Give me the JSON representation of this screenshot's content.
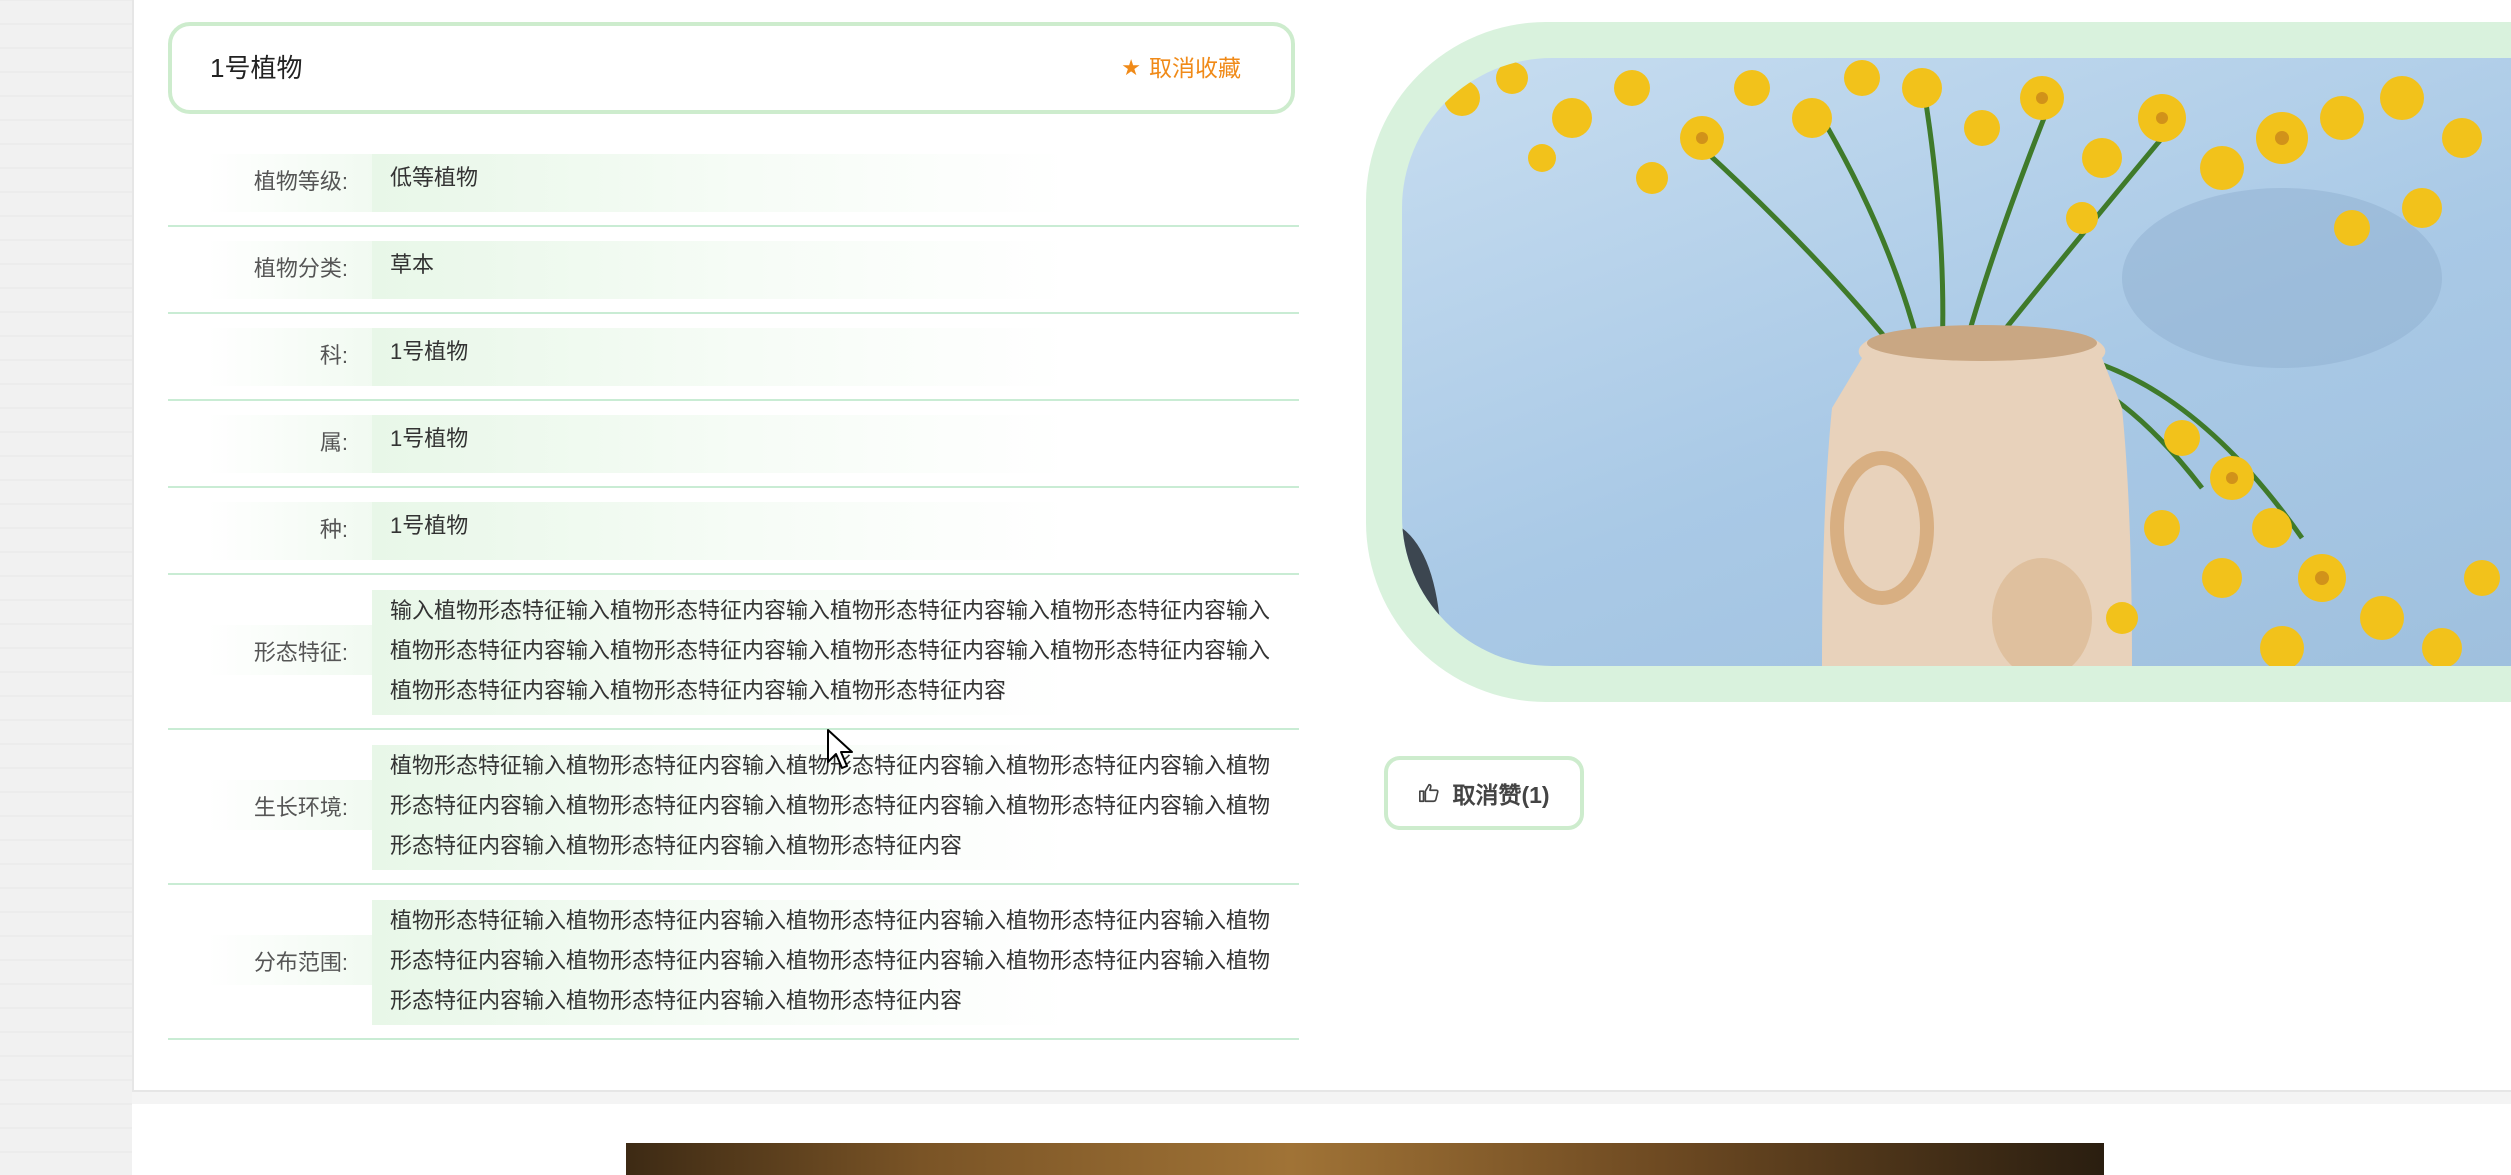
{
  "plant": {
    "title": "1号植物",
    "favorite_label": "取消收藏",
    "favorite_icon": "star-icon",
    "accent_color": "#f08a18"
  },
  "details": [
    {
      "label": "植物等级:",
      "value": "低等植物"
    },
    {
      "label": "植物分类:",
      "value": "草本"
    },
    {
      "label": "科:",
      "value": "1号植物"
    },
    {
      "label": "属:",
      "value": "1号植物"
    },
    {
      "label": "种:",
      "value": "1号植物"
    },
    {
      "label": "形态特征:",
      "value": "输入植物形态特征输入植物形态特征内容输入植物形态特征内容输入植物形态特征内容输入植物形态特征内容输入植物形态特征内容输入植物形态特征内容输入植物形态特征内容输入植物形态特征内容输入植物形态特征内容输入植物形态特征内容"
    },
    {
      "label": "生长环境:",
      "value": "植物形态特征输入植物形态特征内容输入植物形态特征内容输入植物形态特征内容输入植物形态特征内容输入植物形态特征内容输入植物形态特征内容输入植物形态特征内容输入植物形态特征内容输入植物形态特征内容输入植物形态特征内容"
    },
    {
      "label": "分布范围:",
      "value": "植物形态特征输入植物形态特征内容输入植物形态特征内容输入植物形态特征内容输入植物形态特征内容输入植物形态特征内容输入植物形态特征内容输入植物形态特征内容输入植物形态特征内容输入植物形态特征内容输入植物形态特征内容"
    }
  ],
  "like": {
    "label": "取消赞(1)",
    "icon": "thumbs-up-icon"
  },
  "colors": {
    "frame_green": "#cdeccd",
    "row_border": "#c9ecd4",
    "sky_blue": "#b5d3ec",
    "flower_yellow": "#f2c21b"
  }
}
